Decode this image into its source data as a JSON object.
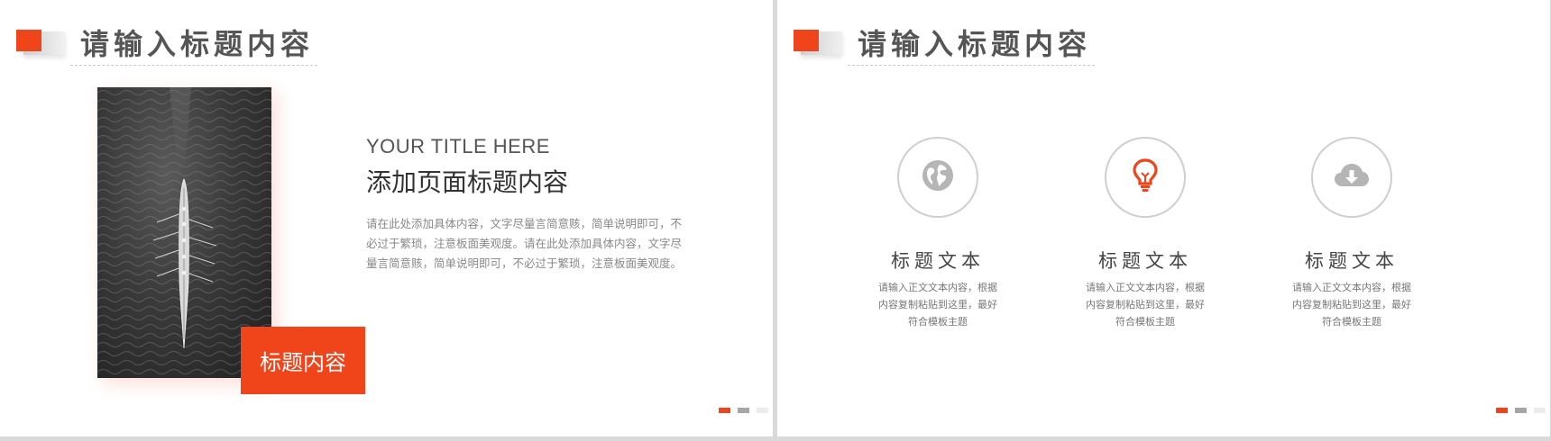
{
  "left_slide": {
    "header": {
      "title": "请输入标题内容"
    },
    "photo": {
      "subject": "rowing-boat-on-water"
    },
    "tag": {
      "label": "标题内容"
    },
    "en_title": "YOUR TITLE HERE",
    "cn_title": "添加页面标题内容",
    "body": "请在此处添加具体内容，文字尽量言简意赅，简单说明即可，不必过于繁琐，注意板面美观度。请在此处添加具体内容，文字尽量言简意赅，简单说明即可，不必过于繁琐，注意板面美观度。"
  },
  "right_slide": {
    "header": {
      "title": "请输入标题内容"
    },
    "features": [
      {
        "icon": "globe-icon",
        "title": "标题文本",
        "desc": "请输入正文文本内容，根据内容复制粘贴到这里，最好符合模板主题"
      },
      {
        "icon": "lightbulb-icon",
        "title": "标题文本",
        "desc": "请输入正文文本内容，根据内容复制粘贴到这里，最好符合模板主题"
      },
      {
        "icon": "cloud-download-icon",
        "title": "标题文本",
        "desc": "请输入正文文本内容，根据内容复制粘贴到这里，最好符合模板主题"
      }
    ]
  },
  "colors": {
    "accent": "#f0441b",
    "icon_gray": "#b5b5b5",
    "pager_mid": "#a6a6a6",
    "pager_light": "#ececec"
  }
}
